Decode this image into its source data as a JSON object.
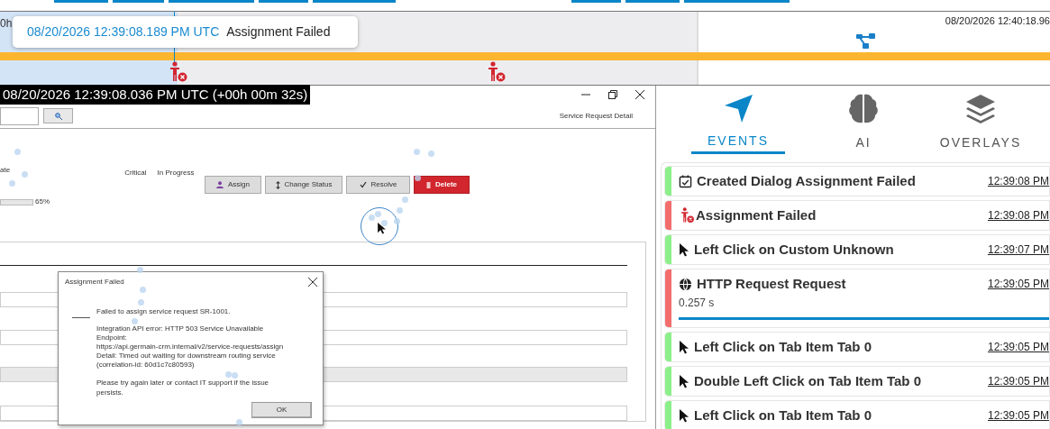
{
  "timeline": {
    "start_label": "0h",
    "end_label": "08/20/2026 12:40:18.96",
    "tooltip": {
      "time": "08/20/2026 12:39:08.189 PM UTC",
      "event": "Assignment Failed"
    }
  },
  "replay": {
    "timestamp": "08/20/2026 12:39:08.036 PM UTC (+00h 00m 32s)",
    "page_title": "Service Request Detail",
    "labels": [
      "ate",
      "Critical",
      "In Progress"
    ],
    "actions": [
      {
        "label": "Assign",
        "kind": "assign"
      },
      {
        "label": "Change Status",
        "kind": "status"
      },
      {
        "label": "Resolve",
        "kind": "resolve"
      },
      {
        "label": "Delete",
        "kind": "delete"
      }
    ],
    "progress": {
      "reading": "65%"
    },
    "dialog": {
      "title": "Assignment Failed",
      "message": "Failed to assign service request SR-1001.",
      "details": [
        "Integration API error: HTTP 503 Service Unavailable",
        "Endpoint:",
        "https://api.germain-crm.internal/v2/service-requests/assign",
        "Detail: Timed out waiting for downstream routing service",
        "(correlation-id: 60d1c7c80593)"
      ],
      "hint": "Please try again later or contact IT support if the issue persists.",
      "button": "OK"
    }
  },
  "panel": {
    "tabs": [
      {
        "label": "EVENTS",
        "kind": "events",
        "selected": true
      },
      {
        "label": "AI",
        "kind": "ai",
        "selected": false
      },
      {
        "label": "OVERLAYS",
        "kind": "overlays",
        "selected": false
      }
    ],
    "events": [
      {
        "kind": "dialog",
        "title": "Created Dialog Assignment Failed",
        "time": "12:39:08 PM",
        "color": "#8cf08a"
      },
      {
        "kind": "error",
        "title": "Assignment Failed",
        "time": "12:39:08 PM",
        "color": "#f46d6d"
      },
      {
        "kind": "click",
        "title": "Left Click on Custom Unknown",
        "time": "12:39:07 PM",
        "color": "#8cf08a"
      },
      {
        "kind": "http",
        "title": "HTTP Request Request",
        "time": "12:39:05 PM",
        "color": "#f46d6d",
        "duration": "0.257 s",
        "level": 1
      },
      {
        "kind": "click",
        "title": "Left Click on Tab Item Tab 0",
        "time": "12:39:05 PM",
        "color": "#8cf08a"
      },
      {
        "kind": "click",
        "title": "Double Left Click on Tab Item Tab 0",
        "time": "12:39:05 PM",
        "color": "#8cf08a"
      },
      {
        "kind": "click",
        "title": "Left Click on Tab Item Tab 0",
        "time": "12:39:05 PM",
        "color": "#8cf08a"
      }
    ]
  }
}
